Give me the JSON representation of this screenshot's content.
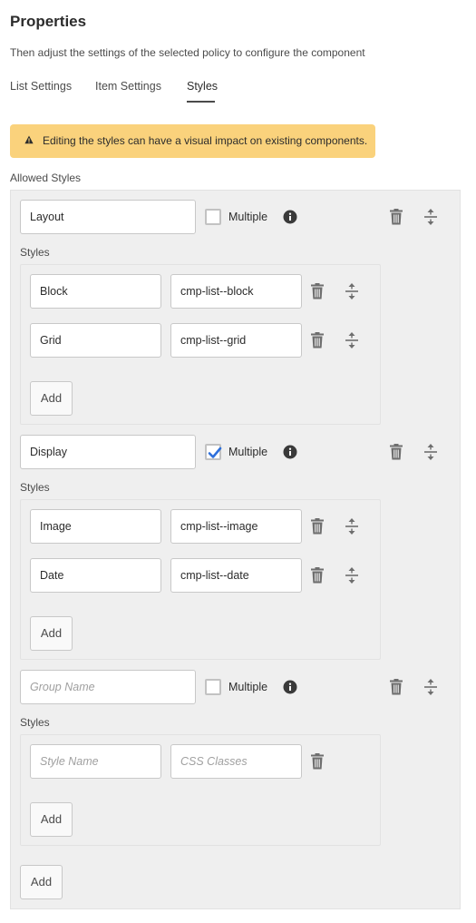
{
  "page": {
    "title": "Properties",
    "subtitle": "Then adjust the settings of the selected policy to configure the component"
  },
  "tabs": [
    {
      "label": "List Settings",
      "active": false
    },
    {
      "label": "Item Settings",
      "active": false
    },
    {
      "label": "Styles",
      "active": true
    }
  ],
  "alert": {
    "icon": "warning-icon",
    "text": "Editing the styles can have a visual impact on existing components.",
    "color": "#fad27c"
  },
  "allowed_styles_label": "Allowed Styles",
  "multiple_label": "Multiple",
  "styles_label": "Styles",
  "add_label": "Add",
  "groups": [
    {
      "name": "Layout",
      "multiple": false,
      "styles": [
        {
          "name": "Block",
          "classes": "cmp-list--block"
        },
        {
          "name": "Grid",
          "classes": "cmp-list--grid"
        }
      ]
    },
    {
      "name": "Display",
      "multiple": true,
      "styles": [
        {
          "name": "Image",
          "classes": "cmp-list--image"
        },
        {
          "name": "Date",
          "classes": "cmp-list--date"
        }
      ]
    },
    {
      "name_placeholder": "Group Name",
      "multiple": false,
      "styles": [
        {
          "name_placeholder": "Style Name",
          "classes_placeholder": "CSS Classes"
        }
      ]
    }
  ],
  "colors": {
    "checkbox_checked": "#2d6fdb",
    "alert_bg": "#fad27c",
    "panel_bg": "#efefef"
  }
}
